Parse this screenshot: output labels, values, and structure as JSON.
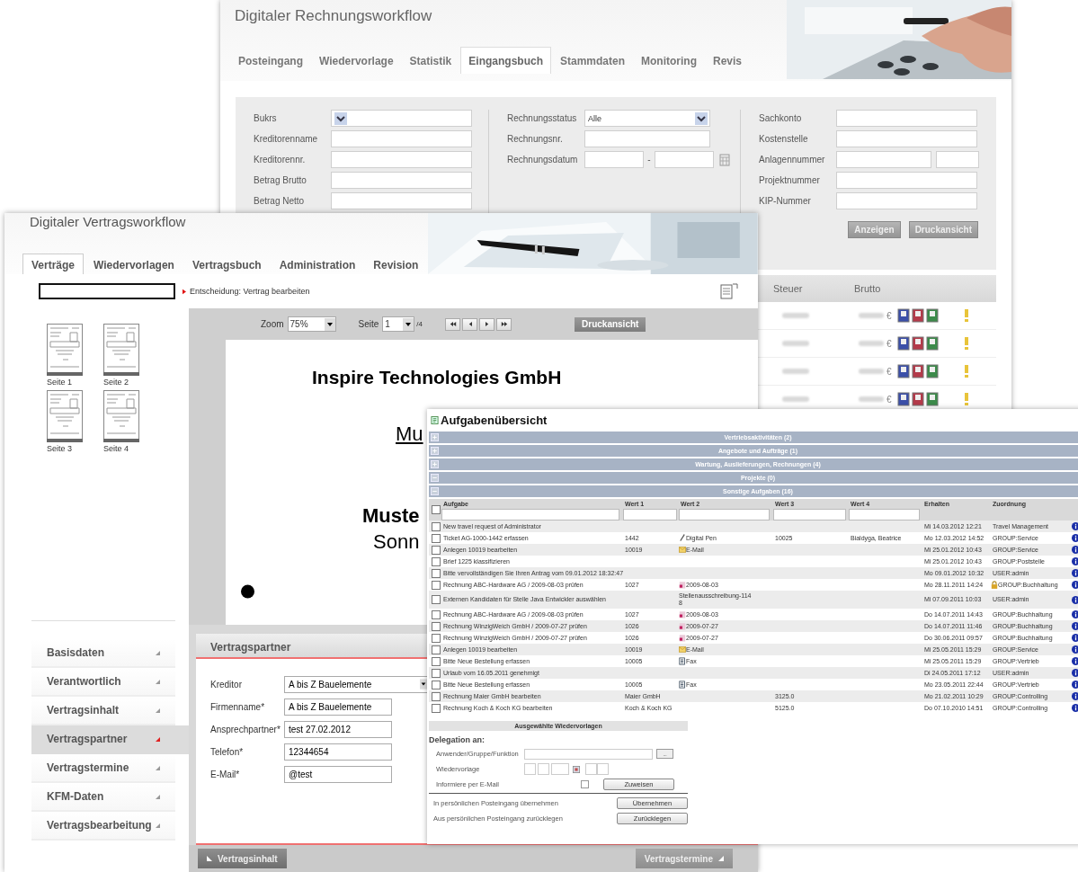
{
  "invoice_window": {
    "title": "Digitaler Rechnungsworkflow",
    "tabs": [
      {
        "label": "Posteingang",
        "selected": false
      },
      {
        "label": "Wiedervorlage",
        "selected": false
      },
      {
        "label": "Statistik",
        "selected": false
      },
      {
        "label": "Eingangsbuch",
        "selected": true
      },
      {
        "label": "Stammdaten",
        "selected": false
      },
      {
        "label": "Monitoring",
        "selected": false
      },
      {
        "label": "Revis",
        "selected": false
      }
    ],
    "filter_columns": [
      [
        {
          "label": "Bukrs",
          "kind": "select"
        },
        {
          "label": "Kreditorenname",
          "kind": "input"
        },
        {
          "label": "Kreditorennr.",
          "kind": "input"
        },
        {
          "label": "Betrag Brutto",
          "kind": "input"
        },
        {
          "label": "Betrag Netto",
          "kind": "input"
        }
      ],
      [
        {
          "label": "Rechnungsstatus",
          "kind": "select",
          "value": "Alle"
        },
        {
          "label": "Rechnungsnr.",
          "kind": "input"
        },
        {
          "label": "Rechnungsdatum",
          "kind": "range",
          "separator": "-"
        }
      ],
      [
        {
          "label": "Sachkonto",
          "kind": "input"
        },
        {
          "label": "Kostenstelle",
          "kind": "input"
        },
        {
          "label": "Anlagennummer",
          "kind": "pair"
        },
        {
          "label": "Projektnummer",
          "kind": "input"
        },
        {
          "label": "KIP-Nummer",
          "kind": "input"
        }
      ]
    ],
    "buttons": [
      "Anzeigen",
      "Druckansicht"
    ],
    "columns": [
      "Steuer",
      "Brutto"
    ],
    "rows": [
      {
        "currency": "€"
      },
      {
        "currency": "€"
      },
      {
        "currency": "€"
      },
      {
        "currency": "€"
      }
    ]
  },
  "contract_window": {
    "title": "Digitaler Vertragsworkflow",
    "tabs": [
      {
        "label": "Verträge",
        "selected": true
      },
      {
        "label": "Wiedervorlagen",
        "selected": false
      },
      {
        "label": "Vertragsbuch",
        "selected": false
      },
      {
        "label": "Administration",
        "selected": false
      },
      {
        "label": "Revision",
        "selected": false
      }
    ],
    "breadcrumb": "Entscheidung: Vertrag bearbeiten",
    "thumbnails": [
      "Seite 1",
      "Seite 2",
      "Seite 3",
      "Seite 4"
    ],
    "viewer": {
      "zoom_label": "Zoom",
      "zoom": "75%",
      "page_label": "Seite",
      "page": "1",
      "page_total": "/4",
      "print": "Druckansicht"
    },
    "document": [
      {
        "text": "Inspire Technologies GmbH",
        "kind": "title"
      },
      {
        "text": "Mu",
        "kind": "underlined"
      },
      {
        "text": "Muste",
        "kind": "bold"
      },
      {
        "text": "Sonn",
        "kind": "plain"
      }
    ],
    "nav": [
      {
        "label": "Basisdaten",
        "selected": false
      },
      {
        "label": "Verantwortlich",
        "selected": false
      },
      {
        "label": "Vertragsinhalt",
        "selected": false
      },
      {
        "label": "Vertragspartner",
        "selected": true
      },
      {
        "label": "Vertragstermine",
        "selected": false
      },
      {
        "label": "KFM-Daten",
        "selected": false
      },
      {
        "label": "Vertragsbearbeitung",
        "selected": false
      }
    ],
    "panel": {
      "title": "Vertragspartner",
      "fields": [
        {
          "label": "Kreditor",
          "value": "A bis Z Bauelemente",
          "kind": "select"
        },
        {
          "label": "Firmenname*",
          "value": "A bis Z Bauelemente",
          "kind": "input"
        },
        {
          "label": "Ansprechpartner*",
          "value": "test 27.02.2012",
          "kind": "input"
        },
        {
          "label": "Telefon*",
          "value": "12344654",
          "kind": "input"
        },
        {
          "label": "E-Mail*",
          "value": "@test",
          "kind": "input"
        }
      ]
    },
    "footer": {
      "back": "Vertragsinhalt",
      "next": "Vertragstermine"
    }
  },
  "task_window": {
    "title": "Aufgabenübersicht",
    "groups": [
      {
        "label": "Vertriebsaktivitäten (2)",
        "expanded": false
      },
      {
        "label": "Angebote und Aufträge (1)",
        "expanded": false
      },
      {
        "label": "Wartung, Auslieferungen, Rechnungen (4)",
        "expanded": false
      },
      {
        "label": "Projekte (0)",
        "expanded": true
      },
      {
        "label": "Sonstige Aufgaben (16)",
        "expanded": true
      }
    ],
    "header_checked": false,
    "columns": [
      "Aufgabe",
      "Wert 1",
      "Wert 2",
      "Wert 3",
      "Wert 4",
      "Erhalten",
      "Zuordnung"
    ],
    "rows": [
      {
        "checked": false,
        "task": "New travel request of Administrator",
        "wert1": "",
        "wert2": "",
        "kind": "plain",
        "wert3": "",
        "wert4": "",
        "received": "Mi 14.03.2012 12:21",
        "assigned": "Travel Management",
        "locked": false
      },
      {
        "checked": false,
        "task": "Ticket AG-1000-1442 erfassen",
        "wert1": "1442",
        "wert2": "Digital Pen",
        "kind": "pen",
        "wert3": "10025",
        "wert4": "Bialdyga, Beatrice",
        "received": "Mo 12.03.2012 14:52",
        "assigned": "GROUP:Service",
        "locked": false
      },
      {
        "checked": false,
        "task": "Anlegen 10019 bearbeiten",
        "wert1": "10019",
        "wert2": "E-Mail",
        "kind": "mail",
        "wert3": "",
        "wert4": "",
        "received": "Mi 25.01.2012 10:43",
        "assigned": "GROUP:Service",
        "locked": false
      },
      {
        "checked": false,
        "task": "Brief 1225 klassifizieren",
        "wert1": "",
        "wert2": "",
        "kind": "plain",
        "wert3": "",
        "wert4": "",
        "received": "Mi 25.01.2012 10:43",
        "assigned": "GROUP:Poststelle",
        "locked": false
      },
      {
        "checked": false,
        "task": "Bitte vervollständigen Sie Ihren Antrag vom 09.01.2012 18:32:47",
        "wert1": "",
        "wert2": "",
        "kind": "plain",
        "wert3": "",
        "wert4": "",
        "received": "Mo 09.01.2012 10:32",
        "assigned": "USER:admin",
        "locked": false
      },
      {
        "checked": false,
        "task": "Rechnung ABC-Hardware AG / 2009-08-03 prüfen",
        "wert1": "1027",
        "wert2": "2009-08-03",
        "kind": "pdf",
        "wert3": "",
        "wert4": "",
        "received": "Mo 28.11.2011 14:24",
        "assigned": "GROUP:Buchhaltung",
        "locked": true
      },
      {
        "checked": false,
        "task": "Externen Kandidaten für Stelle Java Entwickler auswählen",
        "wert1": "",
        "wert2": "Stellenausschreibung-1148",
        "kind": "plain",
        "wert3": "",
        "wert4": "",
        "received": "Mi 07.09.2011 10:03",
        "assigned": "USER:admin",
        "locked": false
      },
      {
        "checked": false,
        "task": "Rechnung ABC-Hardware AG / 2009-08-03 prüfen",
        "wert1": "1027",
        "wert2": "2009-08-03",
        "kind": "pdf",
        "wert3": "",
        "wert4": "",
        "received": "Do 14.07.2011 14:43",
        "assigned": "GROUP:Buchhaltung",
        "locked": false
      },
      {
        "checked": false,
        "task": "Rechnung WinzigWeich GmbH / 2009-07-27 prüfen",
        "wert1": "1026",
        "wert2": "2009-07-27",
        "kind": "pdf",
        "wert3": "",
        "wert4": "",
        "received": "Do 14.07.2011 11:46",
        "assigned": "GROUP:Buchhaltung",
        "locked": false
      },
      {
        "checked": false,
        "task": "Rechnung WinzigWeich GmbH / 2009-07-27 prüfen",
        "wert1": "1026",
        "wert2": "2009-07-27",
        "kind": "pdf",
        "wert3": "",
        "wert4": "",
        "received": "Do 30.06.2011 09:57",
        "assigned": "GROUP:Buchhaltung",
        "locked": false
      },
      {
        "checked": false,
        "task": "Anlegen 10019 bearbeiten",
        "wert1": "10019",
        "wert2": "E-Mail",
        "kind": "mail",
        "wert3": "",
        "wert4": "",
        "received": "Mi 25.05.2011 15:29",
        "assigned": "GROUP:Service",
        "locked": false
      },
      {
        "checked": false,
        "task": "Bitte Neue Bestellung erfassen",
        "wert1": "10005",
        "wert2": "Fax",
        "kind": "fax",
        "wert3": "",
        "wert4": "",
        "received": "Mi 25.05.2011 15:29",
        "assigned": "GROUP:Vertrieb",
        "locked": false
      },
      {
        "checked": false,
        "task": "Urlaub vom 16.05.2011 genehmigt",
        "wert1": "",
        "wert2": "",
        "kind": "plain",
        "wert3": "",
        "wert4": "",
        "received": "Di 24.05.2011 17:12",
        "assigned": "USER:admin",
        "locked": false
      },
      {
        "checked": false,
        "task": "Bitte Neue Bestellung erfassen",
        "wert1": "10005",
        "wert2": "Fax",
        "kind": "fax",
        "wert3": "",
        "wert4": "",
        "received": "Mo 23.05.2011 22:44",
        "assigned": "GROUP:Vertrieb",
        "locked": false
      },
      {
        "checked": false,
        "task": "Rechnung Maier GmbH bearbeiten",
        "wert1": "Maier GmbH",
        "wert2": "",
        "kind": "plain",
        "wert3": "3125.0",
        "wert4": "",
        "received": "Mo 21.02.2011 10:29",
        "assigned": "GROUP:Controlling",
        "locked": false
      },
      {
        "checked": false,
        "task": "Rechnung Koch & Koch KG bearbeiten",
        "wert1": "Koch & Koch KG",
        "wert2": "",
        "kind": "plain",
        "wert3": "5125.0",
        "wert4": "",
        "received": "Do 07.10.2010 14:51",
        "assigned": "GROUP:Controlling",
        "locked": false
      }
    ],
    "followups_bar": "Ausgewählte Wiedervorlagen",
    "delegation": {
      "title": "Delegation an:",
      "user_label": "Anwender/Gruppe/Funktion",
      "browse": "...",
      "followup_label": "Wiedervorlage",
      "email_label": "Informiere per E-Mail",
      "email_checked": false,
      "assign": "Zuweisen",
      "take_label": "In persönlichen Posteingang übernehmen",
      "take": "Übernehmen",
      "return_label": "Aus persönlichen Posteingang zurücklegen",
      "return": "Zurücklegen"
    }
  }
}
